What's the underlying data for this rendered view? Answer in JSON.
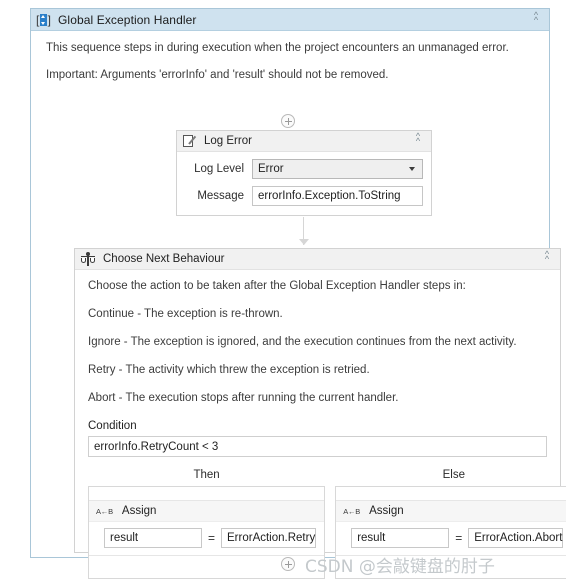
{
  "handler": {
    "icon": "sequence-icon",
    "title": "Global Exception Handler",
    "collapse_label": "«",
    "description_line_1": "This sequence steps in during execution when the project encounters an unmanaged error.",
    "description_line_2": "Important: Arguments 'errorInfo' and 'result' should not be removed."
  },
  "add_buttons": {
    "top_label": "+",
    "bottom_label": "+"
  },
  "log_error": {
    "icon": "document-pencil-icon",
    "title": "Log Error",
    "fields": [
      {
        "label": "Log Level",
        "value": "Error",
        "type": "combobox"
      },
      {
        "label": "Message",
        "value": "errorInfo.Exception.ToString",
        "type": "textbox"
      }
    ]
  },
  "choose_next_behaviour": {
    "icon": "scales-decision-icon",
    "title": "Choose Next Behaviour",
    "lines": [
      "Choose the action to be taken after the Global Exception Handler steps in:",
      "Continue - The exception is re-thrown.",
      "Ignore - The exception is ignored, and the execution continues from the next activity.",
      "Retry - The activity which threw the exception is retried.",
      "Abort - The execution stops after running the current handler."
    ],
    "condition_label": "Condition",
    "condition_value": "errorInfo.RetryCount < 3",
    "branches": [
      {
        "header": "Then",
        "activity_icon": "a-to-b-icon",
        "activity_icon_text": "A←B",
        "activity_title": "Assign",
        "to": "result",
        "operator": "=",
        "value": "ErrorAction.Retry"
      },
      {
        "header": "Else",
        "activity_icon": "a-to-b-icon",
        "activity_icon_text": "A←B",
        "activity_title": "Assign",
        "to": "result",
        "operator": "=",
        "value": "ErrorAction.Abort"
      }
    ]
  },
  "watermark": "CSDN @会敲键盘的肘子",
  "colors": {
    "title_bar": "#cfe2ef",
    "outer_border": "#a9c6d8",
    "activity_header": "#f1f1f1",
    "accent_icon": "#2a7fc9"
  }
}
